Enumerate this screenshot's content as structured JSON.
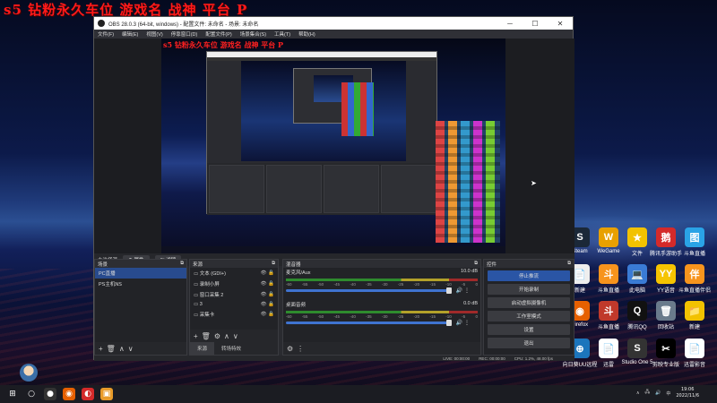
{
  "banner_text": "s5 钻粉永久车位 游戏名 战神 平台 P",
  "obs": {
    "title": "OBS 28.0.3 (64-bit, windows) - 配置文件: 未命名 - 场景: 未命名",
    "menu": [
      "文件(F)",
      "编辑(E)",
      "视图(V)",
      "停靠窗口(D)",
      "配置文件(P)",
      "场景集合(S)",
      "工具(T)",
      "帮助(H)"
    ],
    "canvas_title": "s5 钻粉永久车位 游戏名 战神 平台 P",
    "scenebar": {
      "label": "未选择源",
      "btn1": "属性",
      "btn2": "滤镜"
    },
    "scenes": {
      "title": "场景",
      "items": [
        "PC直播",
        "PS主机NS"
      ],
      "selected": 0
    },
    "sources": {
      "title": "来源",
      "items": [
        "文本 (GDI+)",
        "录制小屏",
        "窗口采集 2",
        "3",
        "采集卡"
      ]
    },
    "mixer": {
      "title": "混音器",
      "channels": [
        {
          "name": "麦克风/Aux",
          "db": "10.0 dB"
        },
        {
          "name": "桌面音频",
          "db": "0.0 dB"
        }
      ],
      "ticks": [
        "-60",
        "-55",
        "-50",
        "-45",
        "-40",
        "-35",
        "-30",
        "-25",
        "-20",
        "-15",
        "-10",
        "-5",
        "0"
      ]
    },
    "controls": {
      "title": "控件",
      "buttons": [
        "停止推流",
        "开始录制",
        "启动虚拟摄像机",
        "工作室模式",
        "设置",
        "退出"
      ]
    },
    "bottom_tabs": [
      "来源",
      "转场特效"
    ],
    "status": {
      "live": "LIVE: 00:00:00",
      "rec": "REC: 00:00:00",
      "cpu": "CPU: 1.2%, 48.00 fps"
    }
  },
  "desktop_icons": [
    {
      "label": "Steam",
      "color": "#1b2838",
      "glyph": "S"
    },
    {
      "label": "WeGame",
      "color": "#e8a000",
      "glyph": "W"
    },
    {
      "label": "文件",
      "color": "#f2c200",
      "glyph": "★"
    },
    {
      "label": "腾讯手游助手",
      "color": "#d42a2a",
      "glyph": "鹅"
    },
    {
      "label": "斗鱼直播",
      "color": "#2aa3e6",
      "glyph": "图"
    },
    {
      "label": "新建",
      "color": "#eee",
      "glyph": "📄"
    },
    {
      "label": "斗鱼直播",
      "color": "#f7941d",
      "glyph": "斗"
    },
    {
      "label": "此电脑",
      "color": "#3a7bd5",
      "glyph": "💻"
    },
    {
      "label": "YY语音",
      "color": "#f5c400",
      "glyph": "YY"
    },
    {
      "label": "斗鱼直播伴侣",
      "color": "#f7941d",
      "glyph": "伴"
    },
    {
      "label": "Firefox",
      "color": "#e66000",
      "glyph": "◉"
    },
    {
      "label": "斗鱼直播",
      "color": "#c0392b",
      "glyph": "斗"
    },
    {
      "label": "腾讯QQ",
      "color": "#111",
      "glyph": "Q"
    },
    {
      "label": "回收站",
      "color": "#6a7b8c",
      "glyph": "🗑"
    },
    {
      "label": "新建",
      "color": "#f2c200",
      "glyph": "📁"
    },
    {
      "label": "向日葵UU远程",
      "color": "#1c75bc",
      "glyph": "⊕"
    },
    {
      "label": "迅雷",
      "color": "#fff",
      "glyph": "📄"
    },
    {
      "label": "Studio One 5",
      "color": "#333",
      "glyph": "S"
    },
    {
      "label": "剪映专业版",
      "color": "#000",
      "glyph": "✂"
    },
    {
      "label": "迅雷影音",
      "color": "#fff",
      "glyph": "📄"
    }
  ],
  "taskbar_apps": [
    {
      "name": "start",
      "glyph": "⊞",
      "color": "#1b1c22"
    },
    {
      "name": "search",
      "glyph": "○",
      "color": "#1b1c22"
    },
    {
      "name": "obs",
      "glyph": "●",
      "color": "#333"
    },
    {
      "name": "firefox",
      "glyph": "◉",
      "color": "#e66000"
    },
    {
      "name": "weibo",
      "glyph": "◐",
      "color": "#d42a2a"
    },
    {
      "name": "app",
      "glyph": "▣",
      "color": "#e89b2a"
    }
  ],
  "clock": {
    "time": "19:06",
    "date": "2022/11/6"
  }
}
